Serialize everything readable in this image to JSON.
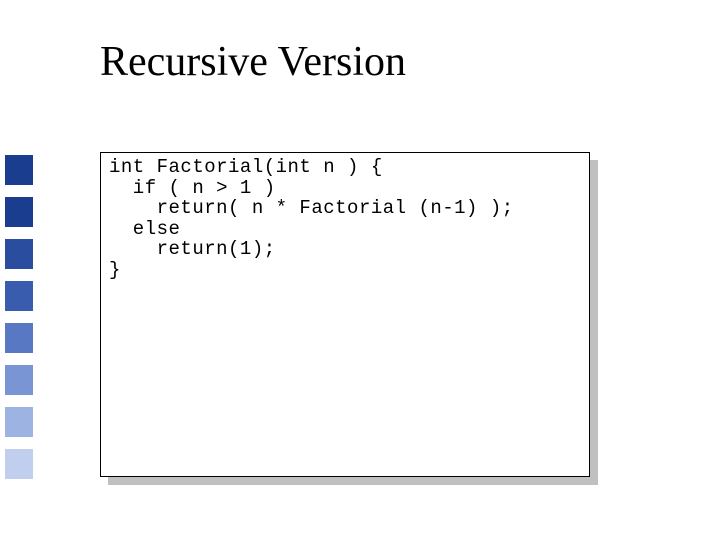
{
  "title": "Recursive Version",
  "sidebar": {
    "colors": [
      "#1a3d8f",
      "#1a3d8f",
      "#2a4d9f",
      "#3a5caf",
      "#5878c4",
      "#7a95d4",
      "#9db3e1",
      "#c1cfee"
    ]
  },
  "code": {
    "lines": [
      "int Factorial(int n ) {",
      "  if ( n > 1 )",
      "    return( n * Factorial (n-1) );",
      "  else",
      "    return(1);",
      "}"
    ]
  }
}
